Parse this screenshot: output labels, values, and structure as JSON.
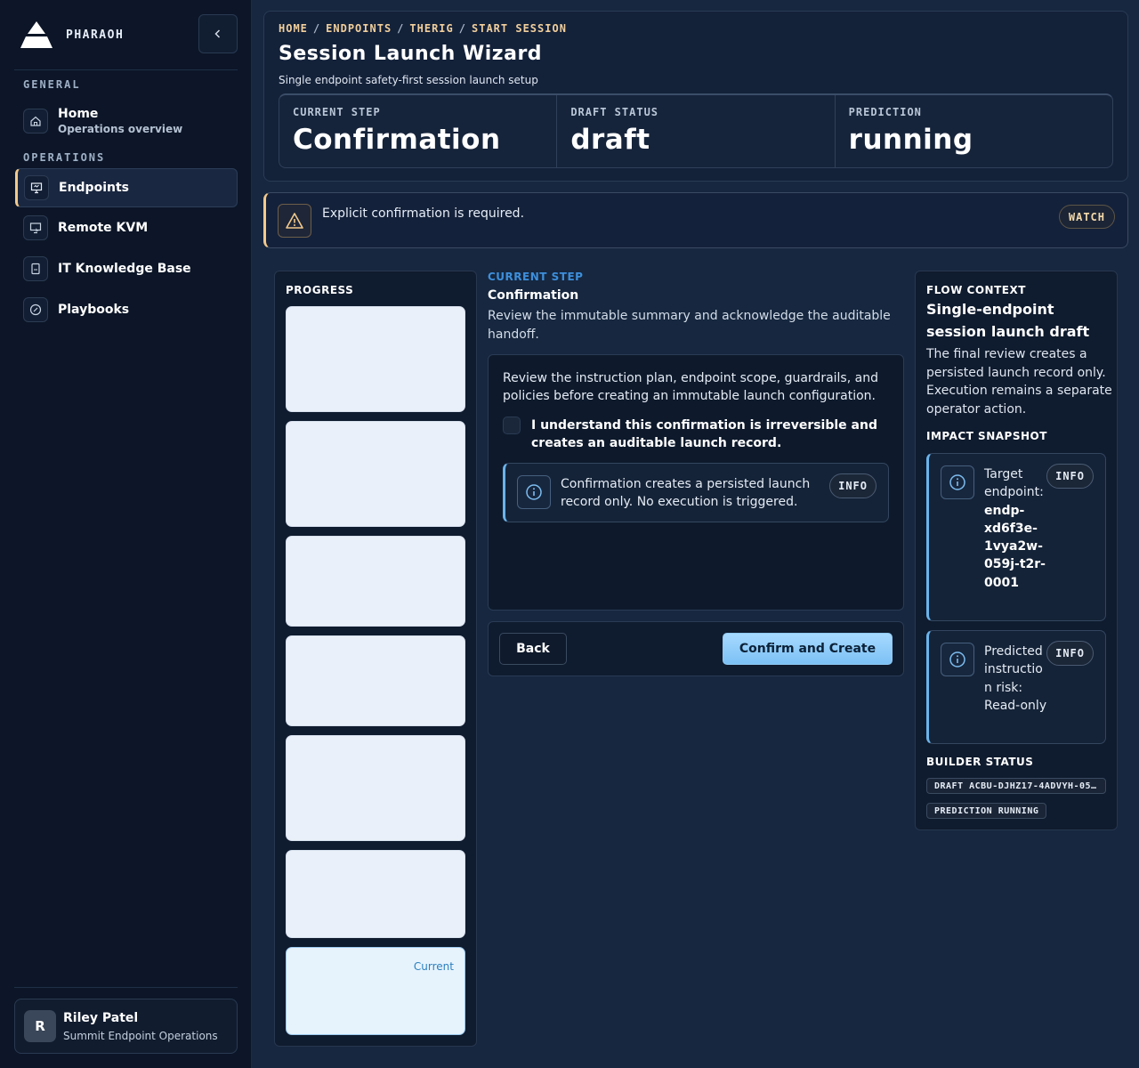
{
  "brand": {
    "name": "PHARAOH"
  },
  "sidebar": {
    "sections": [
      {
        "label": "GENERAL"
      },
      {
        "label": "OPERATIONS"
      }
    ],
    "items": [
      {
        "label": "Home",
        "sublabel": "Operations overview",
        "icon": "home-icon"
      },
      {
        "label": "Endpoints",
        "icon": "monitor-icon",
        "active": true
      },
      {
        "label": "Remote KVM",
        "icon": "remote-screen-icon"
      },
      {
        "label": "IT Knowledge Base",
        "icon": "book-icon"
      },
      {
        "label": "Playbooks",
        "icon": "gauge-icon"
      }
    ],
    "user": {
      "initial": "R",
      "name": "Riley Patel",
      "org": "Summit Endpoint Operations"
    }
  },
  "header": {
    "breadcrumb": [
      "HOME",
      "ENDPOINTS",
      "THERIG",
      "START SESSION"
    ],
    "title": "Session Launch Wizard",
    "subtitle": "Single endpoint safety-first session launch setup",
    "stats": [
      {
        "label": "CURRENT STEP",
        "value": "Confirmation"
      },
      {
        "label": "DRAFT STATUS",
        "value": "draft"
      },
      {
        "label": "PREDICTION",
        "value": "running"
      }
    ]
  },
  "alert": {
    "text": "Explicit confirmation is required.",
    "badge": "WATCH"
  },
  "progress": {
    "heading": "PROGRESS",
    "current_label": "Current"
  },
  "step": {
    "eyebrow": "CURRENT STEP",
    "title": "Confirmation",
    "description": "Review the immutable summary and acknowledge the auditable handoff.",
    "review_text": "Review the instruction plan, endpoint scope, guardrails, and policies before creating an immutable launch configuration.",
    "ack_label": "I understand this confirmation is irreversible and creates an auditable launch record.",
    "info_text": "Confirmation creates a persisted launch record only. No execution is triggered.",
    "info_badge": "INFO",
    "back_label": "Back",
    "confirm_label": "Confirm and Create"
  },
  "context": {
    "heading": "FLOW CONTEXT",
    "title": "Single-endpoint session launch draft",
    "description": "The final review creates a persisted launch record only. Execution remains a separate operator action.",
    "impact_heading": "IMPACT SNAPSHOT",
    "impacts": [
      {
        "label": "Target endpoint:",
        "value": "endp-xd6f3e-1vya2w-059j-t2r-0001",
        "badge": "INFO"
      },
      {
        "label": "Predicted instruction risk:",
        "value": "Read-only",
        "badge": "INFO"
      }
    ],
    "builder_heading": "BUILDER STATUS",
    "chips": [
      "DRAFT ACBU-DJHZ17-4ADVYH-05…",
      "PREDICTION RUNNING"
    ]
  },
  "colors": {
    "accent": "#f3c98b",
    "info": "#6bb3ea",
    "primary_button": "#8fcbf7"
  }
}
